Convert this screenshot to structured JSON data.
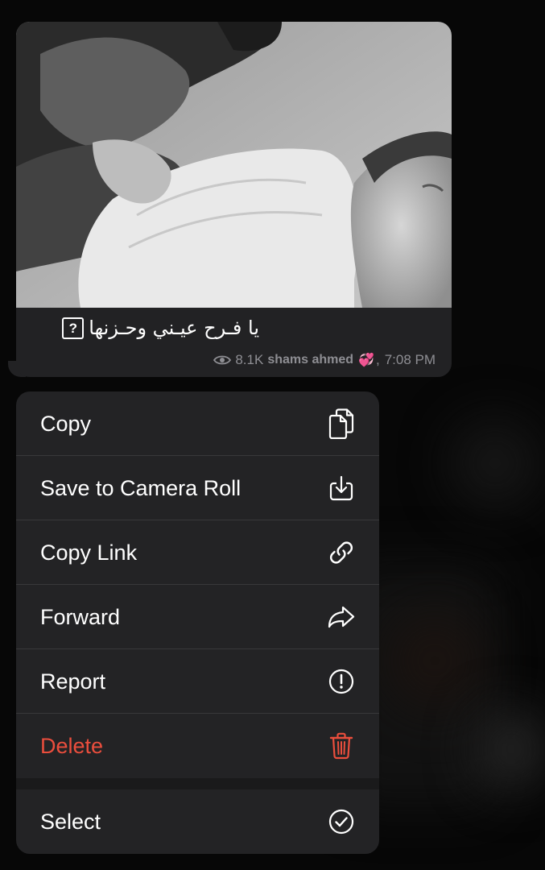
{
  "message": {
    "caption": "يا فـرح عيـني وحـزنها",
    "caption_symbol": "?",
    "views": "8.1K",
    "author": "shams ahmed",
    "author_emoji": "💞",
    "time_separator": ",",
    "time": "7:08 PM"
  },
  "menu": {
    "items": [
      {
        "label": "Copy",
        "icon": "copy-icon"
      },
      {
        "label": "Save to Camera Roll",
        "icon": "save-download-icon"
      },
      {
        "label": "Copy Link",
        "icon": "link-icon"
      },
      {
        "label": "Forward",
        "icon": "forward-arrow-icon"
      },
      {
        "label": "Report",
        "icon": "exclamation-circle-icon"
      },
      {
        "label": "Delete",
        "icon": "trash-icon",
        "color": "#eb4e3d"
      },
      {
        "label": "Select",
        "icon": "checkmark-circle-icon"
      }
    ]
  },
  "colors": {
    "background": "#070707",
    "bubble": "#222224",
    "menu": "#232325",
    "text": "#ffffff",
    "meta": "#8e8e93",
    "destructive": "#eb4e3d"
  }
}
